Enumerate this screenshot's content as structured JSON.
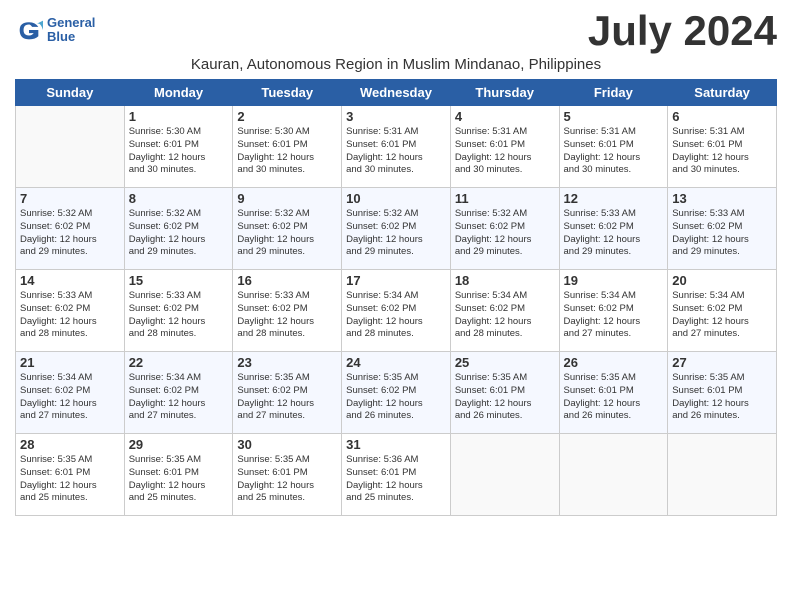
{
  "logo": {
    "line1": "General",
    "line2": "Blue"
  },
  "title": "July 2024",
  "subtitle": "Kauran, Autonomous Region in Muslim Mindanao, Philippines",
  "days_of_week": [
    "Sunday",
    "Monday",
    "Tuesday",
    "Wednesday",
    "Thursday",
    "Friday",
    "Saturday"
  ],
  "weeks": [
    [
      {
        "date": "",
        "info": ""
      },
      {
        "date": "1",
        "info": "Sunrise: 5:30 AM\nSunset: 6:01 PM\nDaylight: 12 hours\nand 30 minutes."
      },
      {
        "date": "2",
        "info": "Sunrise: 5:30 AM\nSunset: 6:01 PM\nDaylight: 12 hours\nand 30 minutes."
      },
      {
        "date": "3",
        "info": "Sunrise: 5:31 AM\nSunset: 6:01 PM\nDaylight: 12 hours\nand 30 minutes."
      },
      {
        "date": "4",
        "info": "Sunrise: 5:31 AM\nSunset: 6:01 PM\nDaylight: 12 hours\nand 30 minutes."
      },
      {
        "date": "5",
        "info": "Sunrise: 5:31 AM\nSunset: 6:01 PM\nDaylight: 12 hours\nand 30 minutes."
      },
      {
        "date": "6",
        "info": "Sunrise: 5:31 AM\nSunset: 6:01 PM\nDaylight: 12 hours\nand 30 minutes."
      }
    ],
    [
      {
        "date": "7",
        "info": "Sunrise: 5:32 AM\nSunset: 6:02 PM\nDaylight: 12 hours\nand 29 minutes."
      },
      {
        "date": "8",
        "info": "Sunrise: 5:32 AM\nSunset: 6:02 PM\nDaylight: 12 hours\nand 29 minutes."
      },
      {
        "date": "9",
        "info": "Sunrise: 5:32 AM\nSunset: 6:02 PM\nDaylight: 12 hours\nand 29 minutes."
      },
      {
        "date": "10",
        "info": "Sunrise: 5:32 AM\nSunset: 6:02 PM\nDaylight: 12 hours\nand 29 minutes."
      },
      {
        "date": "11",
        "info": "Sunrise: 5:32 AM\nSunset: 6:02 PM\nDaylight: 12 hours\nand 29 minutes."
      },
      {
        "date": "12",
        "info": "Sunrise: 5:33 AM\nSunset: 6:02 PM\nDaylight: 12 hours\nand 29 minutes."
      },
      {
        "date": "13",
        "info": "Sunrise: 5:33 AM\nSunset: 6:02 PM\nDaylight: 12 hours\nand 29 minutes."
      }
    ],
    [
      {
        "date": "14",
        "info": "Sunrise: 5:33 AM\nSunset: 6:02 PM\nDaylight: 12 hours\nand 28 minutes."
      },
      {
        "date": "15",
        "info": "Sunrise: 5:33 AM\nSunset: 6:02 PM\nDaylight: 12 hours\nand 28 minutes."
      },
      {
        "date": "16",
        "info": "Sunrise: 5:33 AM\nSunset: 6:02 PM\nDaylight: 12 hours\nand 28 minutes."
      },
      {
        "date": "17",
        "info": "Sunrise: 5:34 AM\nSunset: 6:02 PM\nDaylight: 12 hours\nand 28 minutes."
      },
      {
        "date": "18",
        "info": "Sunrise: 5:34 AM\nSunset: 6:02 PM\nDaylight: 12 hours\nand 28 minutes."
      },
      {
        "date": "19",
        "info": "Sunrise: 5:34 AM\nSunset: 6:02 PM\nDaylight: 12 hours\nand 27 minutes."
      },
      {
        "date": "20",
        "info": "Sunrise: 5:34 AM\nSunset: 6:02 PM\nDaylight: 12 hours\nand 27 minutes."
      }
    ],
    [
      {
        "date": "21",
        "info": "Sunrise: 5:34 AM\nSunset: 6:02 PM\nDaylight: 12 hours\nand 27 minutes."
      },
      {
        "date": "22",
        "info": "Sunrise: 5:34 AM\nSunset: 6:02 PM\nDaylight: 12 hours\nand 27 minutes."
      },
      {
        "date": "23",
        "info": "Sunrise: 5:35 AM\nSunset: 6:02 PM\nDaylight: 12 hours\nand 27 minutes."
      },
      {
        "date": "24",
        "info": "Sunrise: 5:35 AM\nSunset: 6:02 PM\nDaylight: 12 hours\nand 26 minutes."
      },
      {
        "date": "25",
        "info": "Sunrise: 5:35 AM\nSunset: 6:01 PM\nDaylight: 12 hours\nand 26 minutes."
      },
      {
        "date": "26",
        "info": "Sunrise: 5:35 AM\nSunset: 6:01 PM\nDaylight: 12 hours\nand 26 minutes."
      },
      {
        "date": "27",
        "info": "Sunrise: 5:35 AM\nSunset: 6:01 PM\nDaylight: 12 hours\nand 26 minutes."
      }
    ],
    [
      {
        "date": "28",
        "info": "Sunrise: 5:35 AM\nSunset: 6:01 PM\nDaylight: 12 hours\nand 25 minutes."
      },
      {
        "date": "29",
        "info": "Sunrise: 5:35 AM\nSunset: 6:01 PM\nDaylight: 12 hours\nand 25 minutes."
      },
      {
        "date": "30",
        "info": "Sunrise: 5:35 AM\nSunset: 6:01 PM\nDaylight: 12 hours\nand 25 minutes."
      },
      {
        "date": "31",
        "info": "Sunrise: 5:36 AM\nSunset: 6:01 PM\nDaylight: 12 hours\nand 25 minutes."
      },
      {
        "date": "",
        "info": ""
      },
      {
        "date": "",
        "info": ""
      },
      {
        "date": "",
        "info": ""
      }
    ]
  ]
}
